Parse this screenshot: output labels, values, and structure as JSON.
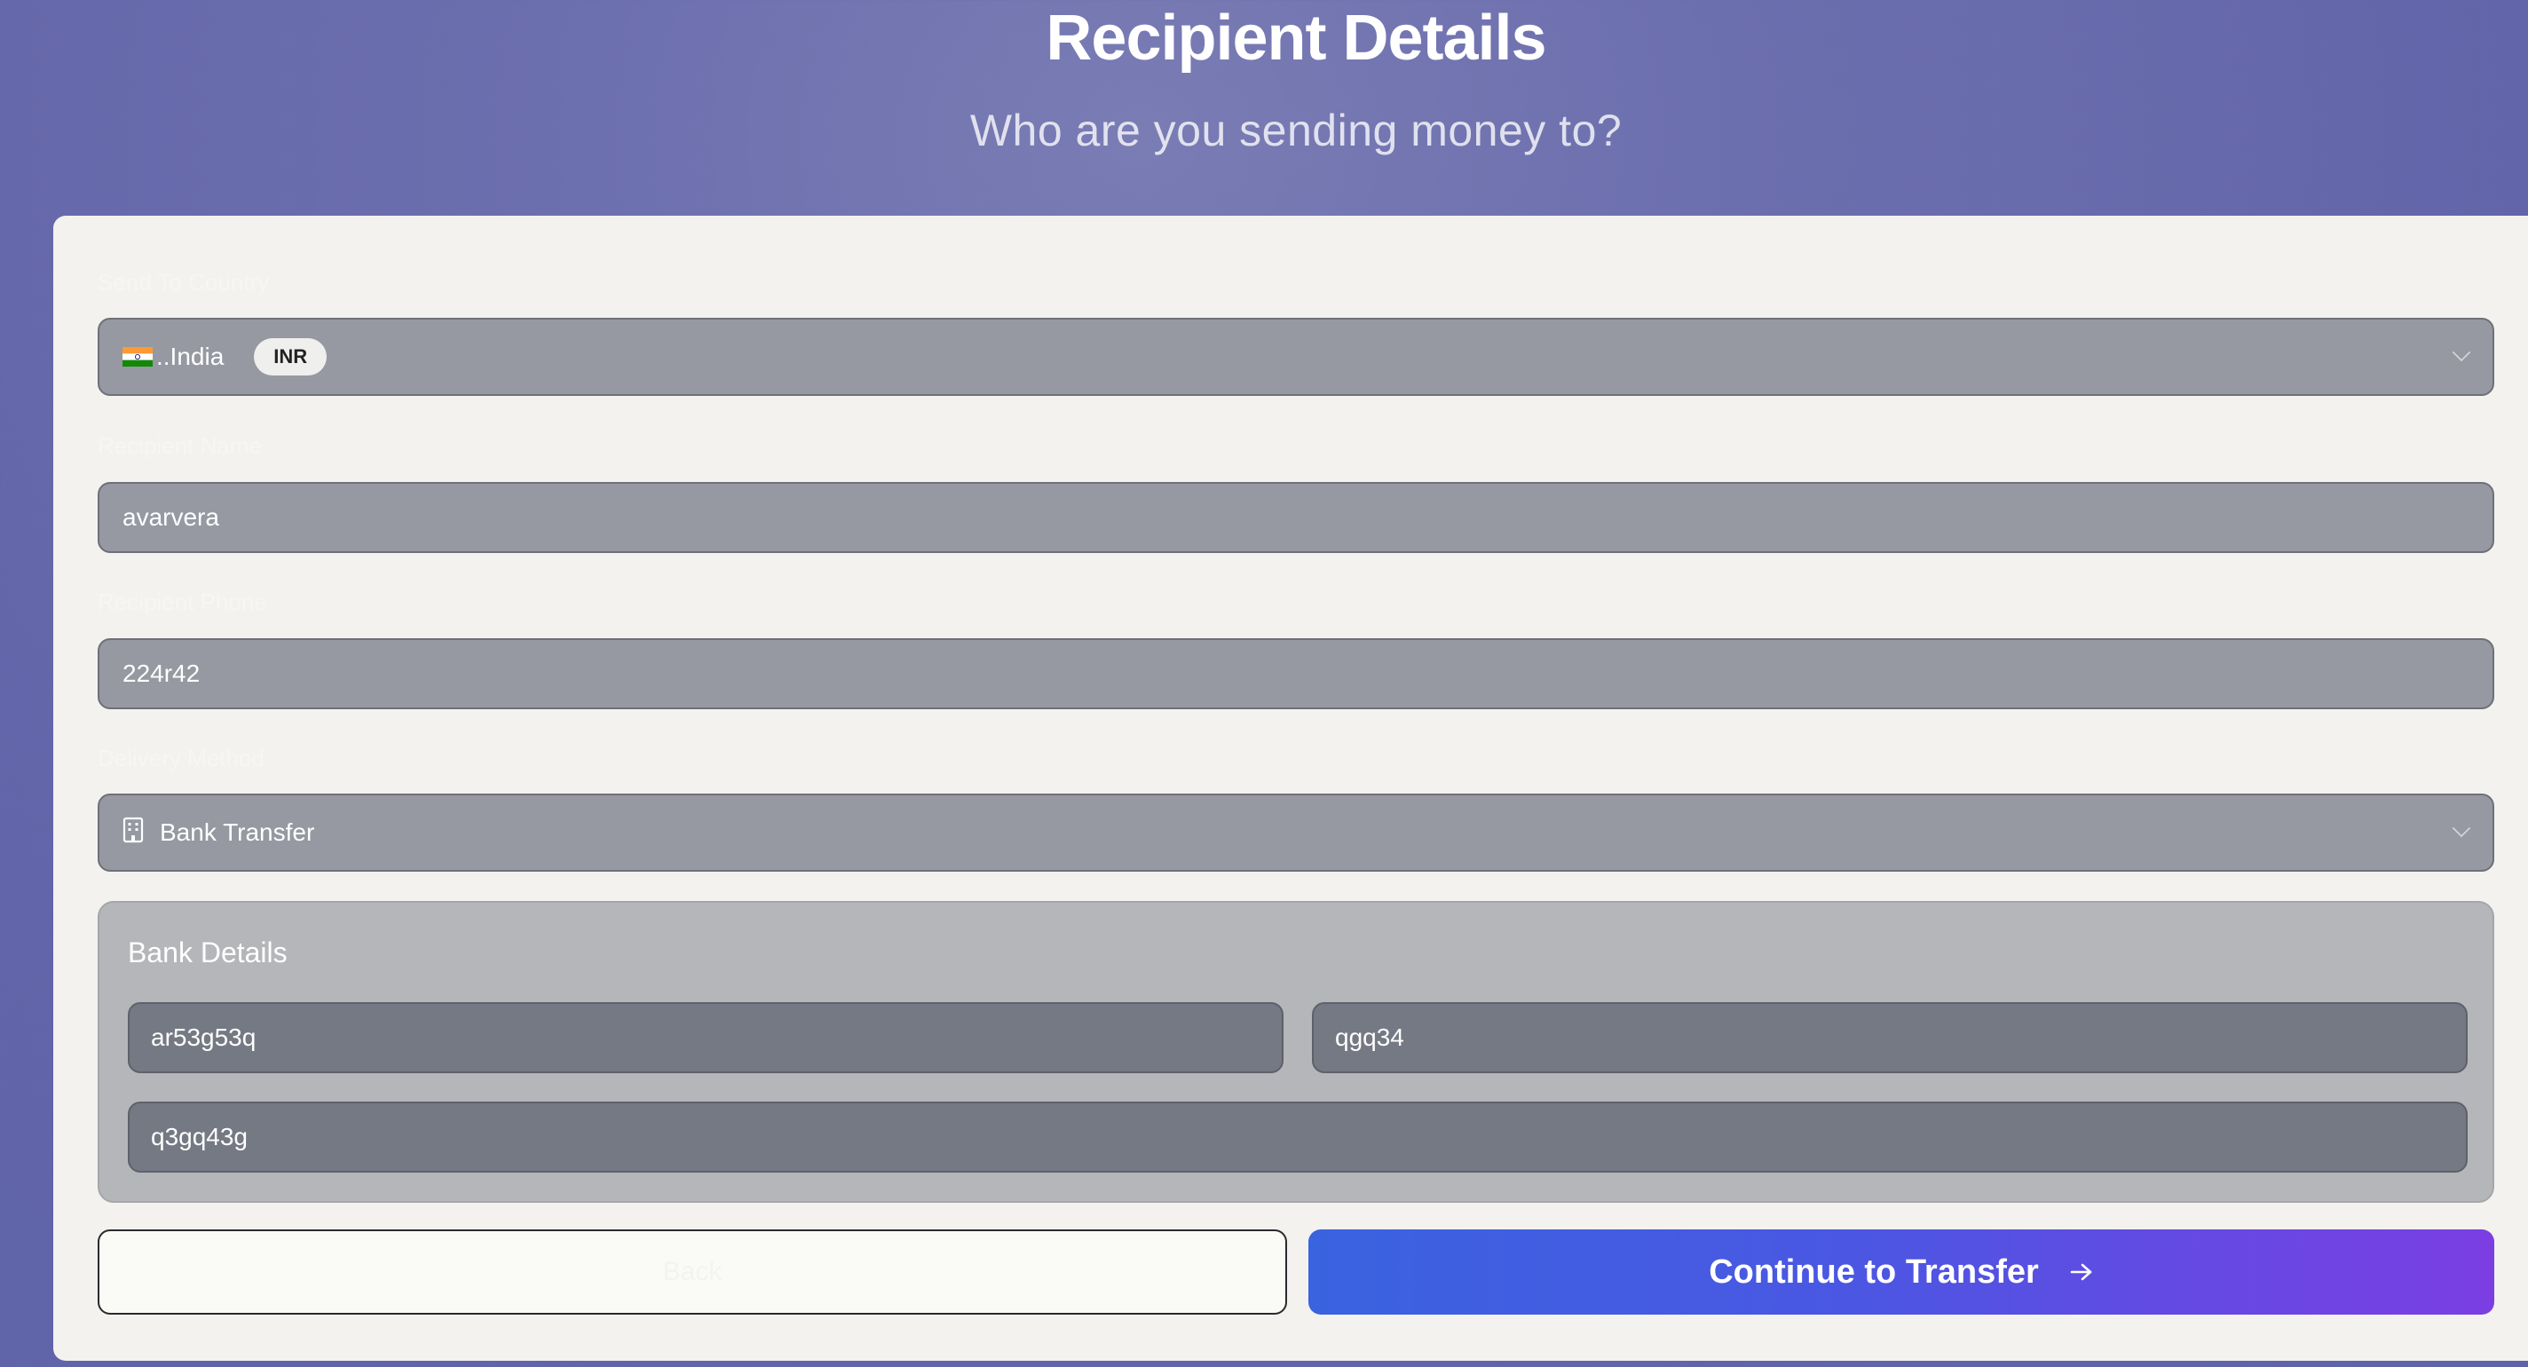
{
  "header": {
    "title": "Recipient Details",
    "subtitle": "Who are you sending money to?"
  },
  "form": {
    "country": {
      "label": "Send To Country",
      "value": "..India",
      "currency_badge": "INR"
    },
    "recipient_name": {
      "label": "Recipient Name",
      "value": "avarvera"
    },
    "recipient_phone": {
      "label": "Recipient Phone",
      "value": "224r42"
    },
    "delivery_method": {
      "label": "Delivery Method",
      "value": "Bank Transfer"
    },
    "bank_details": {
      "title": "Bank Details",
      "field1": "ar53g53q",
      "field2": "qgq34",
      "field3": "q3gq43g"
    }
  },
  "actions": {
    "back_label": "Back",
    "continue_label": "Continue to Transfer"
  },
  "icons": {
    "country_flag": "india-flag-icon",
    "dropdown": "chevron-down-icon",
    "bank": "bank-building-icon",
    "arrow": "arrow-right-icon"
  },
  "colors": {
    "accent_gradient_start": "#3a63e0",
    "accent_gradient_end": "#7b3ee3"
  }
}
